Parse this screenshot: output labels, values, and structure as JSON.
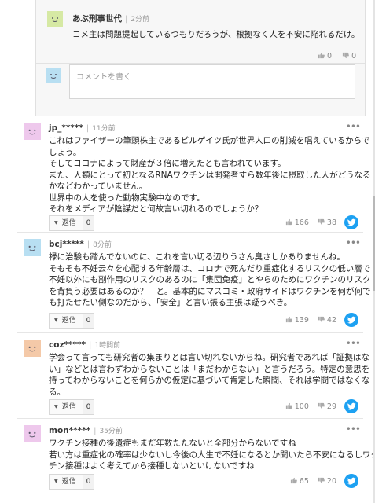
{
  "reply": {
    "username": "あぶ刑事世代",
    "time": "2分前",
    "body": "コメ主は問題提起しているつもりだろうが、根拠なく人を不安に陥れるだけ。",
    "likes": "0",
    "dislikes": "0"
  },
  "reply_form": {
    "placeholder": "コメントを書く"
  },
  "comments": [
    {
      "username": "jp_*****",
      "time": "11分前",
      "lines": [
        "これはファイザーの筆頭株主であるビルゲイツ氏が世界人口の削減を唱えているからで",
        "しょう。",
        "そしてコロナによって財産が３倍に増えたとも言われています。",
        "また、人類にとって初となるRNAワクチンは開発者すら数年後に摂取した人がどうなる",
        "かなどわかっていません。",
        "世界中の人を使った動物実験中なのです。",
        "それをメディアが陰謀だと何故言い切れるのでしょうか？"
      ],
      "reply_label": "返信",
      "reply_count": "0",
      "likes": "166",
      "dislikes": "38"
    },
    {
      "username": "bcj*****",
      "time": "8分前",
      "lines": [
        "禄に治験も踏んでないのに、これを言い切る辺りうさん臭さしかありませんね。",
        "そもそも不妊云々を心配する年齢層は、コロナで死んだり重症化するリスクの低い層で",
        "不妊以外にも副作用のリスクのあるのに「集団免疫」とやらのためにワクチンのリスク",
        "を背負う必要はあるのか？　と。基本的にマスコミ・政府サイドはワクチンを何が何で",
        "も打たせたい側なのだから、「安全」と言い張る主張は疑うべき。"
      ],
      "reply_label": "返信",
      "reply_count": "0",
      "likes": "139",
      "dislikes": "42"
    },
    {
      "username": "coz*****",
      "time": "1時間前",
      "lines": [
        "学会って言っても研究者の集まりとは言い切れないからね。研究者であれば「証拠はな",
        "い」などとは言わずわからないことは「まだわからない」と言うだろう。特定の意思を",
        "持ってわからないことを何らかの仮定に基づいて肯定した瞬間、それは学問ではなくな",
        "る。"
      ],
      "reply_label": "返信",
      "reply_count": "0",
      "likes": "100",
      "dislikes": "29"
    },
    {
      "username": "mon*****",
      "time": "35分前",
      "lines": [
        "ワクチン接種の後遺症もまだ年数たたないと全部分からないですね",
        "若い方は重症化の確率は少ないし今後の人生で不妊になるとか聞いたら不安になるしワク",
        "チン接種はよく考えてから接種しないといけないですね"
      ],
      "reply_label": "返信",
      "reply_count": "0",
      "likes": "65",
      "dislikes": "20"
    }
  ],
  "colors": {
    "twitter": "#1da1f2",
    "avatar_green": "#d6e9a4",
    "avatar_blue": "#b8dff2",
    "avatar_pink": "#eec8ec",
    "avatar_orange": "#f4c9a8"
  }
}
